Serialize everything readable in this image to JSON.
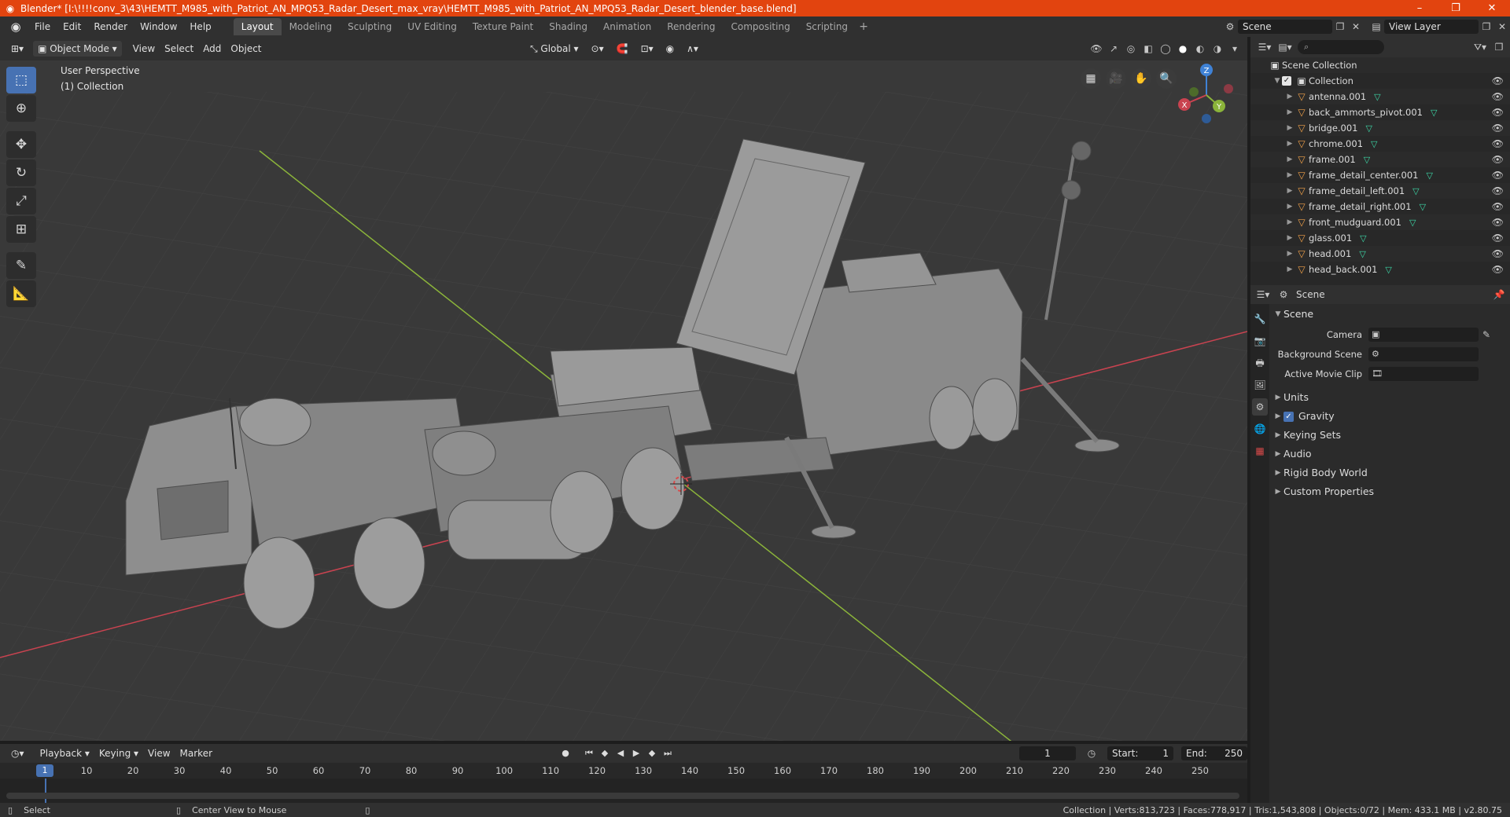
{
  "window": {
    "title": "Blender* [I:\\!!!!conv_3\\43\\HEMTT_M985_with_Patriot_AN_MPQ53_Radar_Desert_max_vray\\HEMTT_M985_with_Patriot_AN_MPQ53_Radar_Desert_blender_base.blend]",
    "minimize": "–",
    "maximize": "❐",
    "close": "✕"
  },
  "menu": [
    "File",
    "Edit",
    "Render",
    "Window",
    "Help"
  ],
  "workspaces": [
    "Layout",
    "Modeling",
    "Sculpting",
    "UV Editing",
    "Texture Paint",
    "Shading",
    "Animation",
    "Rendering",
    "Compositing",
    "Scripting"
  ],
  "active_workspace": "Layout",
  "scene_selector": {
    "scene": "Scene",
    "view_layer": "View Layer"
  },
  "viewport_header": {
    "mode": "Object Mode",
    "menus": [
      "View",
      "Select",
      "Add",
      "Object"
    ],
    "orientation": "Global"
  },
  "viewport": {
    "perspective_label": "User Perspective",
    "collection_label": "(1) Collection",
    "gizmo": {
      "x": "X",
      "y": "Y",
      "z": "Z"
    }
  },
  "outliner": {
    "search_placeholder": "",
    "root": "Scene Collection",
    "collection": "Collection",
    "objects": [
      "antenna.001",
      "back_ammorts_pivot.001",
      "bridge.001",
      "chrome.001",
      "frame.001",
      "frame_detail_center.001",
      "frame_detail_left.001",
      "frame_detail_right.001",
      "front_mudguard.001",
      "glass.001",
      "head.001",
      "head_back.001"
    ]
  },
  "properties": {
    "header_scene": "Scene",
    "panel_title": "Scene",
    "camera_label": "Camera",
    "background_scene_label": "Background Scene",
    "active_movie_clip_label": "Active Movie Clip",
    "sub_panels": [
      "Units",
      "Gravity",
      "Keying Sets",
      "Audio",
      "Rigid Body World",
      "Custom Properties"
    ],
    "gravity_checked": true
  },
  "timeline": {
    "menus": [
      "Playback",
      "Keying",
      "View",
      "Marker"
    ],
    "current_frame": "1",
    "start_label": "Start:",
    "start": "1",
    "end_label": "End:",
    "end": "250",
    "ruler": [
      "1",
      "10",
      "20",
      "30",
      "40",
      "50",
      "60",
      "70",
      "80",
      "90",
      "100",
      "110",
      "120",
      "130",
      "140",
      "150",
      "160",
      "170",
      "180",
      "190",
      "200",
      "210",
      "220",
      "230",
      "240",
      "250"
    ]
  },
  "statusbar": {
    "select": "Select",
    "center_view": "Center View to Mouse",
    "stats": "Collection | Verts:813,723 | Faces:778,917 | Tris:1,543,808 | Objects:0/72 | Mem: 433.1 MB | v2.80.75"
  },
  "colors": {
    "accent": "#4772b3",
    "titlebar": "#e2440f",
    "x_axis": "#c94350",
    "y_axis": "#8bb43a",
    "z_axis": "#3f82d6"
  }
}
